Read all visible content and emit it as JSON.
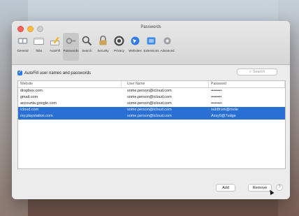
{
  "window": {
    "title": "Passwords"
  },
  "toolbar": [
    {
      "label": "General",
      "icon": "switch-icon"
    },
    {
      "label": "Tabs",
      "icon": "tabs-icon"
    },
    {
      "label": "AutoFill",
      "icon": "pencil-icon"
    },
    {
      "label": "Passwords",
      "icon": "key-icon",
      "selected": true
    },
    {
      "label": "Search",
      "icon": "search-icon"
    },
    {
      "label": "Security",
      "icon": "lock-icon"
    },
    {
      "label": "Privacy",
      "icon": "hand-icon"
    },
    {
      "label": "Websites",
      "icon": "globe-icon"
    },
    {
      "label": "Extensions",
      "icon": "puzzle-icon"
    },
    {
      "label": "Advanced",
      "icon": "gear-icon"
    }
  ],
  "autofill": {
    "label": "AutoFill user names and passwords",
    "checked": true
  },
  "search": {
    "placeholder": "Search"
  },
  "table": {
    "headers": [
      "Website",
      "User Name",
      "Password"
    ],
    "rows": [
      {
        "website": "dropbox.com",
        "user": "some.person@icloud.com",
        "password": "••••••••",
        "selected": false
      },
      {
        "website": "gmail.com",
        "user": "some.person@icloud.com",
        "password": "••••••••",
        "selected": false
      },
      {
        "website": "accounts.google.com",
        "user": "some.person@icloud.com",
        "password": "••••••••",
        "selected": false
      },
      {
        "website": "icloud.com",
        "user": "some.person@icloud.com",
        "password": "ouldfrom@mole",
        "selected": true
      },
      {
        "website": "my.playstation.com",
        "user": "some.person@icloud.com",
        "password": "Avsy5@7udge",
        "selected": true
      }
    ]
  },
  "buttons": {
    "add": "Add",
    "remove": "Remove",
    "help": "?"
  },
  "colors": {
    "selection": "#2a6fd4",
    "accent": "#2f7ae5"
  }
}
